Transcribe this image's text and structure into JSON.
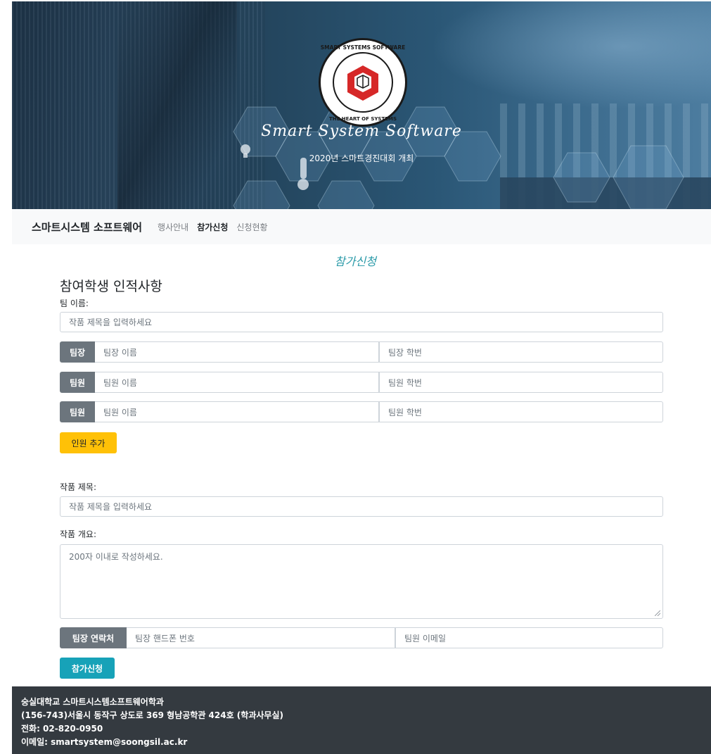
{
  "hero": {
    "logo_ring_top": "SMART SYSTEMS SOFTWARE",
    "logo_ring_bottom": "THE HEART OF SYSTEMS",
    "title": "Smart System Software",
    "subtitle": "2020년 스마트경진대회 개최"
  },
  "navbar": {
    "brand": "스마트시스템 소프트웨어",
    "links": [
      {
        "label": "행사안내",
        "active": false
      },
      {
        "label": "참가신청",
        "active": true
      },
      {
        "label": "신청현황",
        "active": false
      }
    ]
  },
  "page": {
    "heading": "참가신청",
    "section_title": "참여학생 인적사항"
  },
  "form": {
    "team_name_label": "팀 이름:",
    "team_name_placeholder": "작품 제목을 입력하세요",
    "members": [
      {
        "role": "팀장",
        "name_placeholder": "팀장 이름",
        "id_placeholder": "팀장 학번"
      },
      {
        "role": "팀원",
        "name_placeholder": "팀원 이름",
        "id_placeholder": "팀원 학번"
      },
      {
        "role": "팀원",
        "name_placeholder": "팀원 이름",
        "id_placeholder": "팀원 학번"
      }
    ],
    "add_member_label": "인원 추가",
    "work_title_label": "작품 제목:",
    "work_title_placeholder": "작품 제목을 입력하세요",
    "work_summary_label": "작품 개요:",
    "work_summary_placeholder": "200자 이내로 작성하세요.",
    "contact_addon": "팀장 연락처",
    "phone_placeholder": "팀장 핸드폰 번호",
    "email_placeholder": "팀원 이메일",
    "submit_label": "참가신청"
  },
  "footer": {
    "line1": "숭실대학교 스마트시스템소프트웨어학과",
    "line2": "(156-743)서울시 동작구 상도로 369 형남공학관 424호 (학과사무실)",
    "line3": "전화: 02-820-0950",
    "line4": "이메일: smartsystem@soongsil.ac.kr"
  },
  "colors": {
    "accent_heading": "#2a9aa8",
    "add_button": "#ffc107",
    "submit_button": "#17a2b8",
    "addon_gray": "#6c757d",
    "footer_bg": "#343a40"
  }
}
